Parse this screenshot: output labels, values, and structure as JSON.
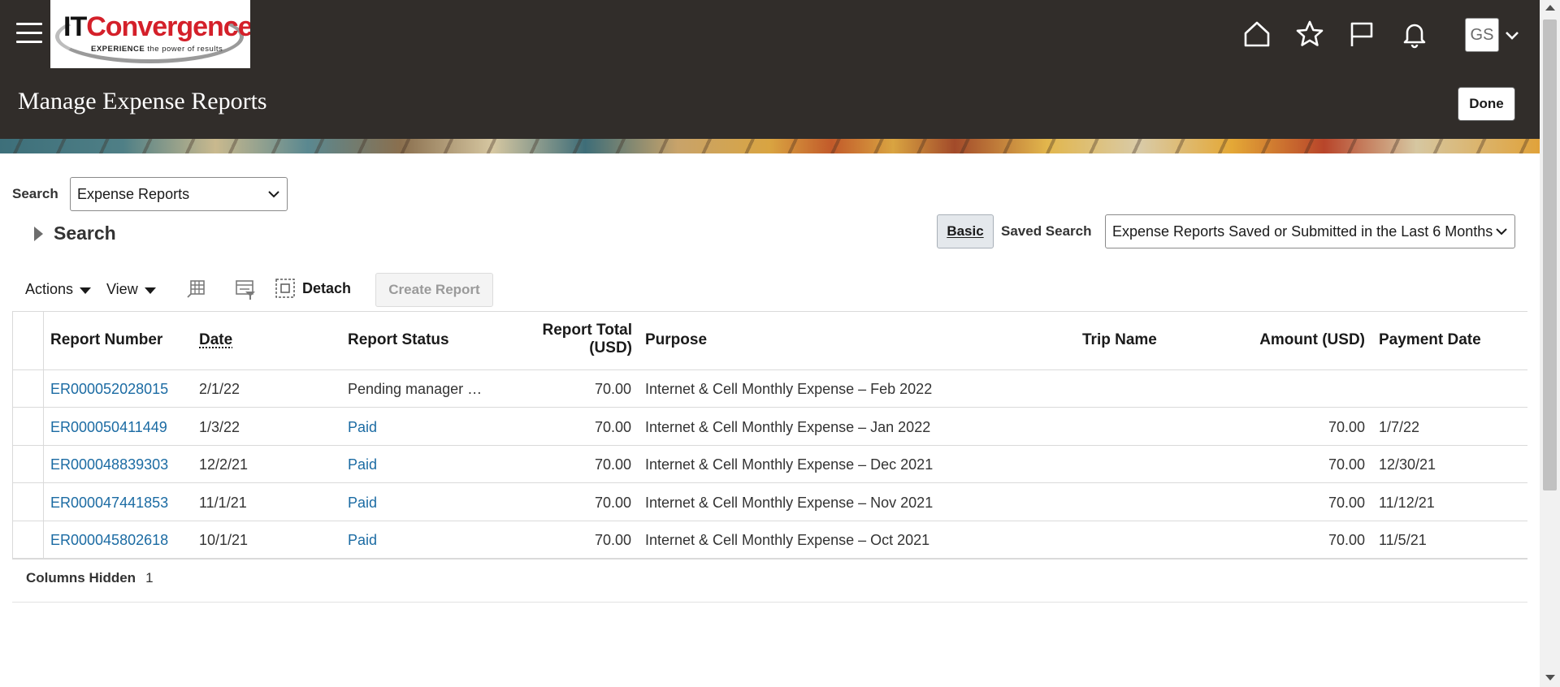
{
  "header": {
    "logo": {
      "brand_it": "IT",
      "brand_rest": "Convergence",
      "tagline_bold": "EXPERIENCE",
      "tagline_rest": " the power of results"
    },
    "avatar_initials": "GS",
    "page_title": "Manage Expense Reports",
    "done_label": "Done",
    "icons": [
      "hamburger-icon",
      "home-icon",
      "star-icon",
      "flag-icon",
      "bell-icon",
      "chevron-down-icon"
    ]
  },
  "search": {
    "label": "Search",
    "selected": "Expense Reports",
    "section_title": "Search",
    "basic_label": "Basic",
    "saved_search_label": "Saved Search",
    "saved_search_value": "Expense Reports Saved or Submitted in the Last 6 Months"
  },
  "toolbar": {
    "actions_label": "Actions",
    "view_label": "View",
    "detach_label": "Detach",
    "create_label": "Create Report"
  },
  "table": {
    "columns": {
      "report_number": "Report Number",
      "date": "Date",
      "report_status": "Report Status",
      "report_total_1": "Report Total",
      "report_total_2": "(USD)",
      "purpose": "Purpose",
      "trip_name": "Trip Name",
      "amount": "Amount (USD)",
      "payment_date": "Payment Date"
    },
    "rows": [
      {
        "number": "ER000052028015",
        "date": "2/1/22",
        "status": "Pending manager …",
        "status_link": false,
        "total": "70.00",
        "purpose": "Internet & Cell Monthly Expense – Feb 2022",
        "trip": "",
        "amount": "",
        "payment_date": ""
      },
      {
        "number": "ER000050411449",
        "date": "1/3/22",
        "status": "Paid",
        "status_link": true,
        "total": "70.00",
        "purpose": "Internet & Cell Monthly Expense – Jan 2022",
        "trip": "",
        "amount": "70.00",
        "payment_date": "1/7/22"
      },
      {
        "number": "ER000048839303",
        "date": "12/2/21",
        "status": "Paid",
        "status_link": true,
        "total": "70.00",
        "purpose": "Internet & Cell Monthly Expense – Dec 2021",
        "trip": "",
        "amount": "70.00",
        "payment_date": "12/30/21"
      },
      {
        "number": "ER000047441853",
        "date": "11/1/21",
        "status": "Paid",
        "status_link": true,
        "total": "70.00",
        "purpose": "Internet & Cell Monthly Expense – Nov 2021",
        "trip": "",
        "amount": "70.00",
        "payment_date": "11/12/21"
      },
      {
        "number": "ER000045802618",
        "date": "10/1/21",
        "status": "Paid",
        "status_link": true,
        "total": "70.00",
        "purpose": "Internet & Cell Monthly Expense – Oct 2021",
        "trip": "",
        "amount": "70.00",
        "payment_date": "11/5/21"
      }
    ],
    "columns_hidden_label": "Columns Hidden",
    "columns_hidden_count": "1"
  },
  "colors": {
    "header_bg": "#312d2a",
    "link": "#1b6ba3"
  }
}
